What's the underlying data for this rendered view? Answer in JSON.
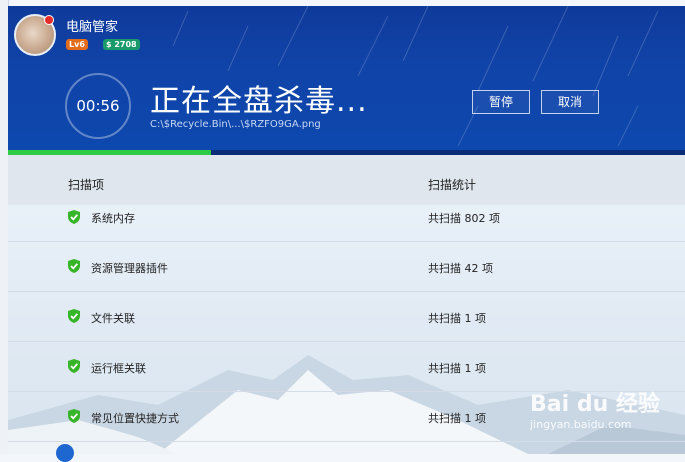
{
  "app": {
    "name": "电脑管家",
    "level_badge": "Lv6",
    "coin_badge": "$ 2708"
  },
  "scan": {
    "timer": "00:56",
    "title": "正在全盘杀毒...",
    "current_path": "C:\\$Recycle.Bin\\...\\$RZFO9GA.png",
    "progress": 0.3
  },
  "buttons": {
    "pause": "暂停",
    "cancel": "取消"
  },
  "columns": {
    "item": "扫描项",
    "stats": "扫描统计"
  },
  "rows": [
    {
      "name": "系统内存",
      "stat": "共扫描 802 项"
    },
    {
      "name": "资源管理器插件",
      "stat": "共扫描 42 项"
    },
    {
      "name": "文件关联",
      "stat": "共扫描 1 项"
    },
    {
      "name": "运行框关联",
      "stat": "共扫描 1 项"
    },
    {
      "name": "常见位置快捷方式",
      "stat": "共扫描 1 项"
    }
  ],
  "watermark": {
    "brand": "Bai du 经验",
    "url": "jingyan.baidu.com"
  },
  "colors": {
    "header_blue": "#1043a8",
    "progress_green": "#2ecb47",
    "check_green": "#37b529"
  }
}
